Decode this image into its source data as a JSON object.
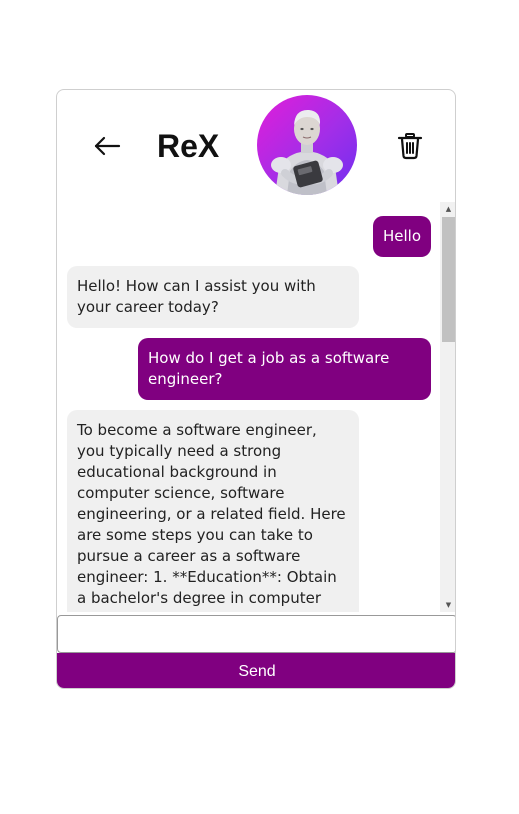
{
  "header": {
    "title": "ReX",
    "back_icon": "arrow-left-icon",
    "delete_icon": "trash-icon",
    "avatar_colors": [
      "#e21dd9",
      "#6f2ff0"
    ]
  },
  "messages": [
    {
      "role": "user",
      "text": "Hello"
    },
    {
      "role": "bot",
      "text": "Hello! How can I assist you with your career today?"
    },
    {
      "role": "user",
      "text": "How do I get a job as a software engineer?"
    },
    {
      "role": "bot",
      "text": "To become a software engineer, you typically need a strong educational background in computer science, software engineering, or a related field. Here are some steps you can take to pursue a career as a software engineer: 1. **Education**: Obtain a bachelor's degree in computer science or a related field. Consider pursuing"
    }
  ],
  "composer": {
    "input_value": "",
    "placeholder": "",
    "send_label": "Send"
  },
  "colors": {
    "accent": "#800080",
    "bot_bubble": "#f0f0f0"
  }
}
